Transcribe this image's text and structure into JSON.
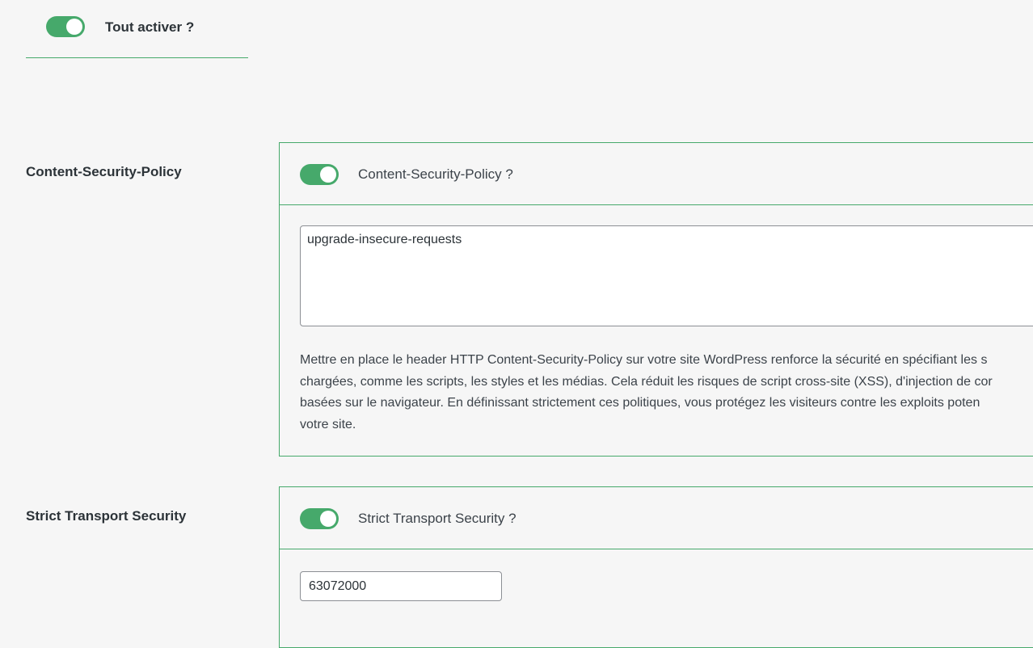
{
  "global": {
    "toggle_label": "Tout activer ?",
    "enabled": true
  },
  "csp": {
    "title": "Content-Security-Policy",
    "toggle_label": "Content-Security-Policy ?",
    "enabled": true,
    "value": "upgrade-insecure-requests",
    "description_lines": [
      "Mettre en place le header HTTP Content-Security-Policy sur votre site WordPress renforce la sécurité en spécifiant les s",
      "chargées, comme les scripts, les styles et les médias. Cela réduit les risques de script cross-site (XSS), d'injection de cor",
      "basées sur le navigateur. En définissant strictement ces politiques, vous protégez les visiteurs contre les exploits poten",
      "votre site."
    ]
  },
  "hsts": {
    "title": "Strict Transport Security",
    "toggle_label": "Strict Transport Security ?",
    "enabled": true,
    "value": "63072000"
  },
  "colors": {
    "accent": "#46a96b",
    "background": "#f6f6f6",
    "text": "#3c434a"
  }
}
